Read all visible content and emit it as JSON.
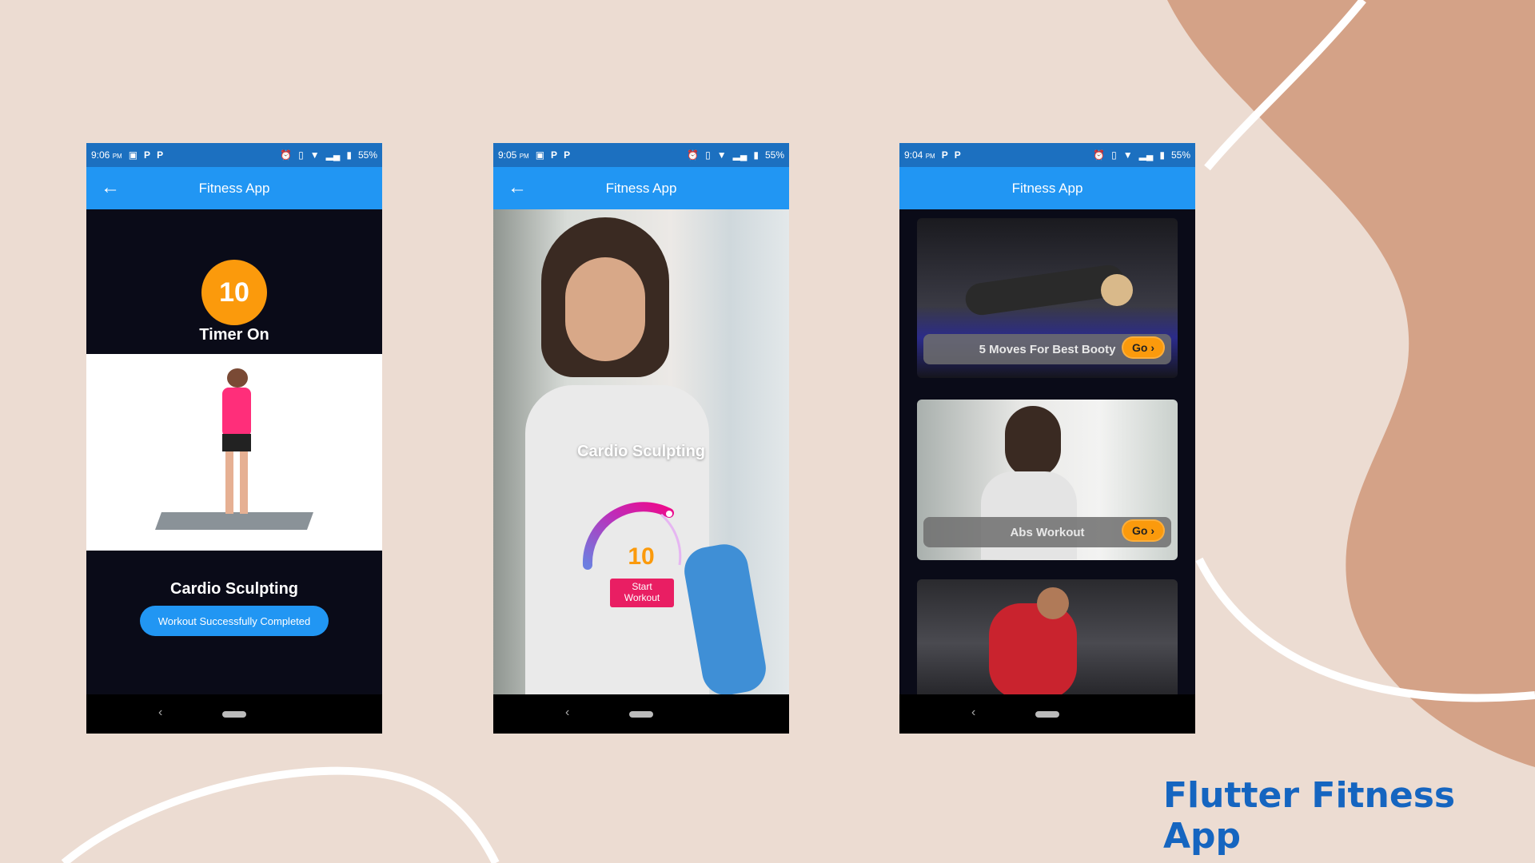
{
  "colors": {
    "background": "#ecdcd2",
    "blob": "#d4a287",
    "app_bar": "#2196f3",
    "status_bar": "#1c70c0",
    "accent_orange": "#fb9a0c",
    "start_pink": "#e91e63",
    "title_blue": "#1565c0"
  },
  "footer_title": "Flutter Fitness App",
  "phones": [
    {
      "status": {
        "time": "9:06",
        "ampm": "PM",
        "battery": "55%",
        "icons": [
          "image-icon",
          "p-icon",
          "p-icon",
          "alarm-icon",
          "vibrate-icon",
          "wifi-icon",
          "signal-icon",
          "battery-icon"
        ]
      },
      "app_title": "Fitness App",
      "timer_value": "10",
      "timer_label": "Timer On",
      "workout_name": "Cardio Sculpting",
      "completed_button": "Workout Successfully Completed"
    },
    {
      "status": {
        "time": "9:05",
        "ampm": "PM",
        "battery": "55%"
      },
      "app_title": "Fitness App",
      "workout_name": "Cardio Sculpting",
      "gauge_value": "10",
      "start_button": "Start Workout"
    },
    {
      "status": {
        "time": "9:04",
        "ampm": "PM",
        "battery": "55%"
      },
      "app_title": "Fitness App",
      "cards": [
        {
          "label": "5 Moves For Best Booty",
          "go": "Go"
        },
        {
          "label": "Abs Workout",
          "go": "Go"
        }
      ]
    }
  ]
}
